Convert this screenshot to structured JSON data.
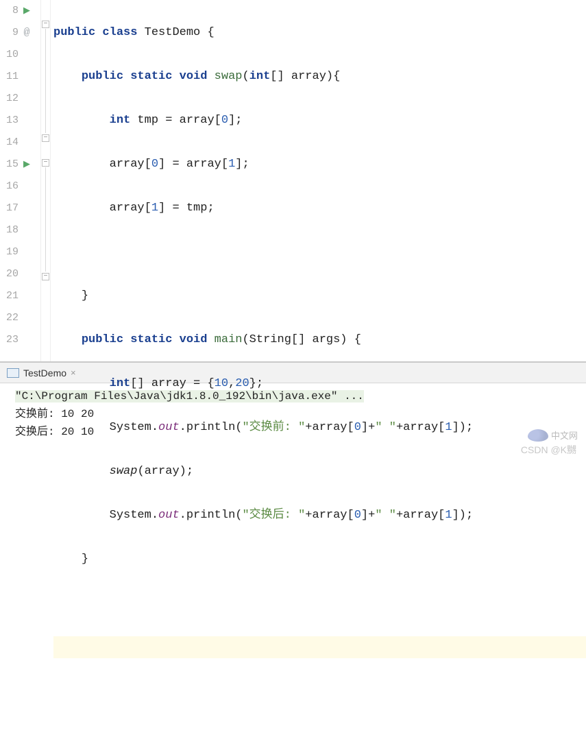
{
  "gutter": {
    "lines": [
      "8",
      "9",
      "10",
      "11",
      "12",
      "13",
      "14",
      "15",
      "16",
      "17",
      "18",
      "19",
      "20",
      "21",
      "22",
      "23"
    ],
    "run_marker": "▶",
    "annotation_marker": "@"
  },
  "code": {
    "l8": {
      "kw1": "public",
      "kw2": "class",
      "cls": "TestDemo",
      "rest": " {"
    },
    "l9": {
      "indent": "    ",
      "kw1": "public",
      "kw2": "static",
      "kw3": "void",
      "fn": "swap",
      "sig": "(",
      "kw4": "int",
      "arr": "[] array){"
    },
    "l10": {
      "indent": "        ",
      "kw1": "int",
      "rest": " tmp = array[",
      "n0": "0",
      "rest2": "];"
    },
    "l11": {
      "indent": "        ",
      "rest": "array[",
      "n0": "0",
      "mid": "] = array[",
      "n1": "1",
      "rest2": "];"
    },
    "l12": {
      "indent": "        ",
      "rest": "array[",
      "n1": "1",
      "rest2": "] = tmp;"
    },
    "l14": {
      "indent": "    ",
      "rest": "}"
    },
    "l15": {
      "indent": "    ",
      "kw1": "public",
      "kw2": "static",
      "kw3": "void",
      "fn": "main",
      "sig": "(String[] args) {"
    },
    "l16": {
      "indent": "        ",
      "kw1": "int",
      "rest": "[] array = {",
      "n0": "10",
      "c": ",",
      "n1": "20",
      "rest2": "};"
    },
    "l17": {
      "indent": "        ",
      "sys": "System.",
      "out": "out",
      "p": ".println(",
      "s": "\"交换前: \"",
      "mid": "+array[",
      "n0": "0",
      "mid2": "]+",
      "s2": "\" \"",
      "mid3": "+array[",
      "n1": "1",
      "end": "]);"
    },
    "l18": {
      "indent": "        ",
      "fn": "swap",
      "rest": "(array);"
    },
    "l19": {
      "indent": "        ",
      "sys": "System.",
      "out": "out",
      "p": ".println(",
      "s": "\"交换后: \"",
      "mid": "+array[",
      "n0": "0",
      "mid2": "]+",
      "s2": "\" \"",
      "mid3": "+array[",
      "n1": "1",
      "end": "]);"
    },
    "l20": {
      "indent": "    ",
      "rest": "}"
    }
  },
  "console": {
    "tab_label": "TestDemo",
    "tab_close": "×",
    "cmd": "\"C:\\Program Files\\Java\\jdk1.8.0_192\\bin\\java.exe\" ...",
    "out1": "交换前: 10 20",
    "out2": "交换后: 20 10"
  },
  "watermark": {
    "text": "中文网",
    "csdn": "CSDN @K嬲"
  }
}
